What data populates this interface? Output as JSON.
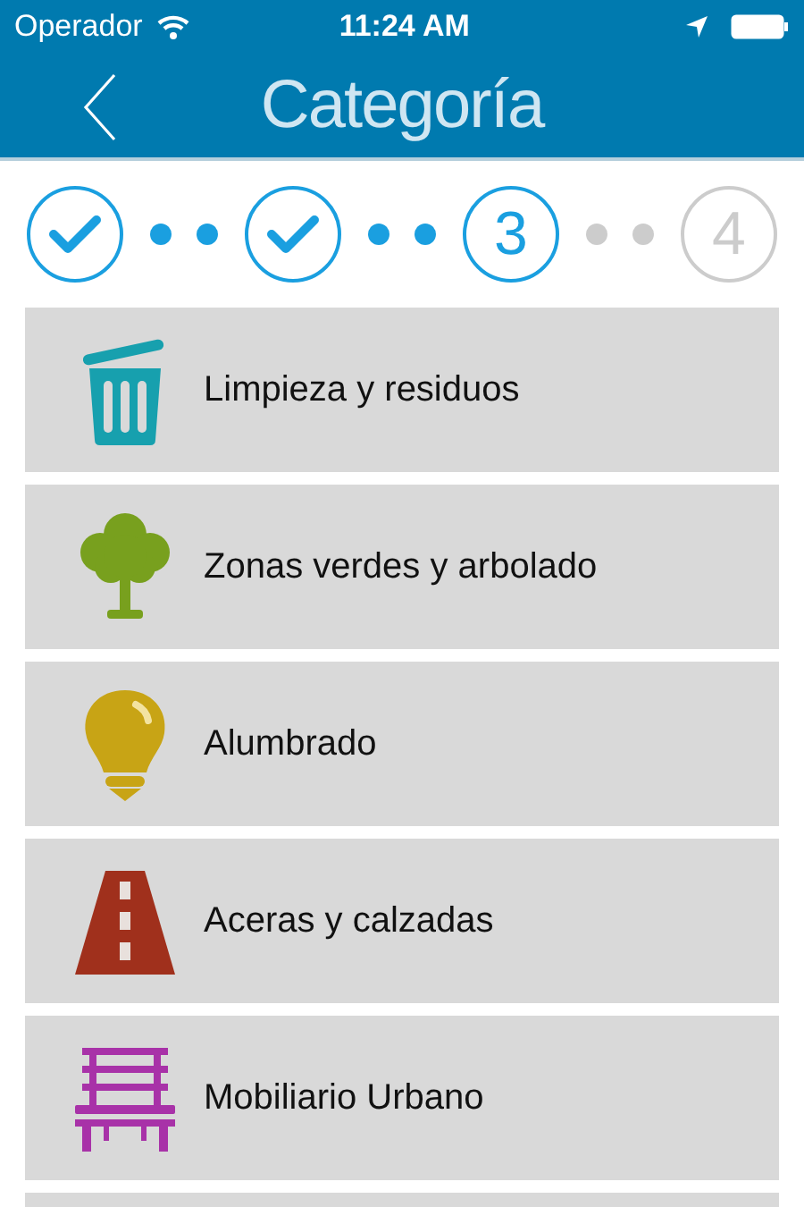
{
  "status_bar": {
    "carrier": "Operador",
    "time": "11:24 AM"
  },
  "nav": {
    "title": "Categoría"
  },
  "steps": [
    {
      "kind": "check"
    },
    {
      "kind": "check"
    },
    {
      "kind": "number",
      "label": "3",
      "active": true
    },
    {
      "kind": "number",
      "label": "4",
      "active": false
    }
  ],
  "categories": [
    {
      "kind": "trash",
      "color": "#17a0ae",
      "label": "Limpieza y residuos"
    },
    {
      "kind": "tree",
      "color": "#78a01e",
      "label": "Zonas verdes y arbolado"
    },
    {
      "kind": "bulb",
      "color": "#c8a415",
      "label": "Alumbrado"
    },
    {
      "kind": "road",
      "color": "#a0301c",
      "label": "Aceras y calzadas"
    },
    {
      "kind": "bench",
      "color": "#a832a8",
      "label": "Mobiliario Urbano"
    }
  ]
}
